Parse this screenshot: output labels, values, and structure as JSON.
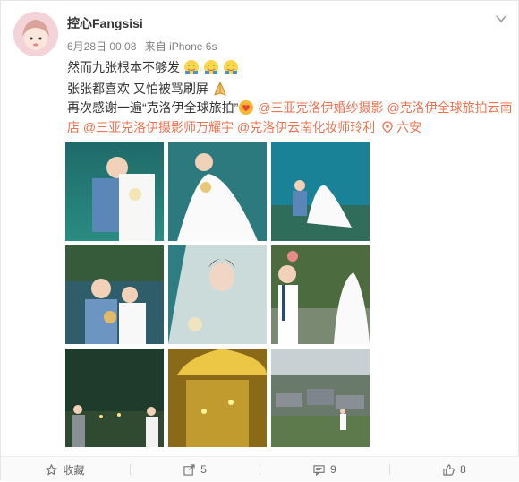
{
  "author": {
    "name": "控心Fangsisi",
    "avatar_icon": "girl-avatar"
  },
  "meta": {
    "date": "6月28日 00:08",
    "source": "来自 iPhone 6s"
  },
  "post": {
    "line1": "然而九张根本不够发",
    "line2": "张张都喜欢 又怕被骂刷屏",
    "line3_prefix": "再次感谢一遍“克洛伊全球旅拍”",
    "mention1": "@三亚克洛伊婚纱摄影",
    "mention2": "@克洛伊全球旅拍云南店",
    "mention3": "@三亚克洛伊摄影师万耀宇",
    "mention4": "@克洛伊云南化妆师玲利",
    "location": "六安",
    "emoji_line1": [
      "smile-hug-icon",
      "smile-hug-icon",
      "smile-hug-icon"
    ],
    "emoji_line2": "praying-hands-icon",
    "emoji_line3": "heart-loop-icon"
  },
  "photos": [
    "wedding-photo-1",
    "wedding-photo-2",
    "wedding-photo-3",
    "wedding-photo-4",
    "wedding-photo-5",
    "wedding-photo-6",
    "wedding-photo-7",
    "wedding-photo-8",
    "wedding-photo-9"
  ],
  "actions": {
    "favorite": "收藏",
    "repost": "5",
    "comment": "9",
    "like": "8"
  },
  "colors": {
    "link": "#eb7350",
    "text": "#333333",
    "muted": "#808080"
  }
}
